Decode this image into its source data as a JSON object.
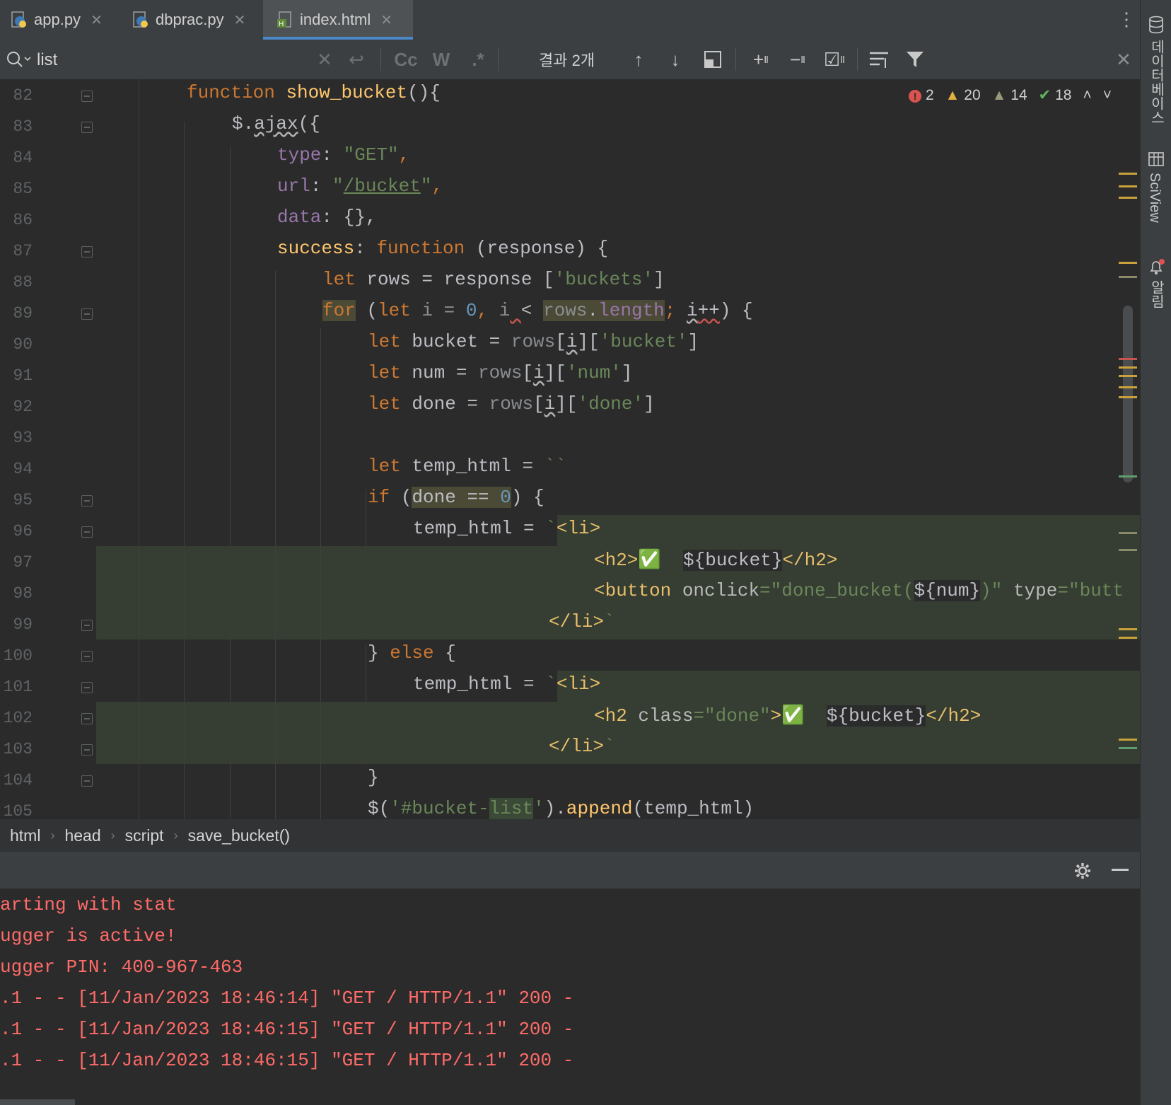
{
  "tabs": [
    {
      "label": "app.py",
      "icon": "python-file-icon",
      "active": false
    },
    {
      "label": "dbprac.py",
      "icon": "python-file-icon",
      "active": false
    },
    {
      "label": "index.html",
      "icon": "html-file-icon",
      "active": true
    }
  ],
  "search": {
    "value": "list",
    "results": "결과 2개",
    "case_label": "Cc",
    "word_label": "W",
    "regex_label": ".*"
  },
  "inspections": {
    "errors": "2",
    "warnings": "20",
    "weak_warnings": "14",
    "ok": "18"
  },
  "right_sidebar": {
    "database": "데이터베이스",
    "sciview": "SciView",
    "notifications": "알림"
  },
  "breadcrumb": [
    "html",
    "head",
    "script",
    "save_bucket()"
  ],
  "line_numbers": [
    "82",
    "83",
    "84",
    "85",
    "86",
    "87",
    "88",
    "89",
    "90",
    "91",
    "92",
    "93",
    "94",
    "95",
    "96",
    "97",
    "98",
    "99",
    "100",
    "101",
    "102",
    "103",
    "104",
    "105"
  ],
  "code": {
    "l82": {
      "kw": "function",
      "name": "show_bucket",
      "rest": "(){"
    },
    "l83": {
      "a": "$.",
      "b": "ajax",
      "c": "({"
    },
    "l84": {
      "key": "type",
      "colon": ": ",
      "val": "\"GET\"",
      "end": ","
    },
    "l85": {
      "key": "url",
      "colon": ": ",
      "q1": "\"",
      "val": "/bucket",
      "q2": "\"",
      "end": ","
    },
    "l86": {
      "key": "data",
      "rest": ": {},"
    },
    "l87": {
      "key": "success",
      "colon": ": ",
      "kw": "function",
      "rest": " (response) {"
    },
    "l88": {
      "kw": "let",
      "mid": " rows = response [",
      "str": "'buckets'",
      "end": "]"
    },
    "l89": {
      "kw": "for",
      "p1": " (",
      "let": "let",
      "p2": " i = ",
      "zero": "0",
      "p3": ", ",
      "i": "i",
      "sp": " ",
      "lt": "<",
      "sp2": " ",
      "rows": "rows",
      "dot": ".",
      "len": "length",
      "semi": ";",
      "p4": " ",
      "ipp": "i",
      "pp": "++",
      "p5": ") {"
    },
    "l90": {
      "kw": "let",
      "mid": " bucket = ",
      "rows": "rows",
      "b1": "[",
      "i": "i",
      "b2": "][",
      "str": "'bucket'",
      "end": "]"
    },
    "l91": {
      "kw": "let",
      "mid": " num = ",
      "rows": "rows",
      "b1": "[",
      "i": "i",
      "b2": "][",
      "str": "'num'",
      "end": "]"
    },
    "l92": {
      "kw": "let",
      "mid": " done = ",
      "rows": "rows",
      "b1": "[",
      "i": "i",
      "b2": "][",
      "str": "'done'",
      "end": "]"
    },
    "l94": {
      "kw": "let",
      "mid": " temp_html = ",
      "tick": "``"
    },
    "l95": {
      "kw": "if",
      "p1": " (",
      "hl": "done == ",
      "zero": "0",
      "p2": ") {"
    },
    "l96": {
      "a": "temp_html = ",
      "tick": "`",
      "tag": "<li>"
    },
    "l97": {
      "t1": "<h2>",
      "emoji": "✅",
      "sp": " ",
      "var": "${bucket}",
      "t2": "</h2>"
    },
    "l98": {
      "t1": "<button ",
      "attr": "onclick",
      "eq": "=",
      "s1": "\"done_bucket(",
      "var": "${num}",
      "s2": ")\"",
      "sp": " ",
      "attr2": "type",
      "eq2": "=",
      "s3": "\"butt"
    },
    "l99": {
      "tag": "</li>",
      "tick": "`"
    },
    "l100": {
      "a": "} ",
      "kw": "else",
      "b": " {"
    },
    "l101": {
      "a": "temp_html = ",
      "tick": "`",
      "tag": "<li>"
    },
    "l102": {
      "t1": "<h2 ",
      "attr": "class",
      "eq": "=",
      "str": "\"done\"",
      "t2": ">",
      "emoji": "✅",
      "sp": " ",
      "var": "${bucket}",
      "t3": "</h2>"
    },
    "l103": {
      "tag": "</li>",
      "tick": "`"
    },
    "l104": {
      "a": "}"
    },
    "l105": {
      "a": "$(",
      "s1": "'#bucket-",
      "hl": "list",
      "s2": "'",
      "b": ").",
      "fn": "append",
      "c": "(temp_html)"
    }
  },
  "log": [
    "arting with stat",
    "ugger is active!",
    "ugger PIN: 400-967-463",
    ".1 - - [11/Jan/2023 18:46:14] \"GET / HTTP/1.1\" 200 -",
    ".1 - - [11/Jan/2023 18:46:15] \"GET / HTTP/1.1\" 200 -",
    ".1 - - [11/Jan/2023 18:46:15] \"GET / HTTP/1.1\" 200 -"
  ],
  "colors": {
    "accent": "#4a88c7",
    "error": "#ff6b68",
    "keyword": "#cc7832",
    "string": "#6a8759"
  }
}
